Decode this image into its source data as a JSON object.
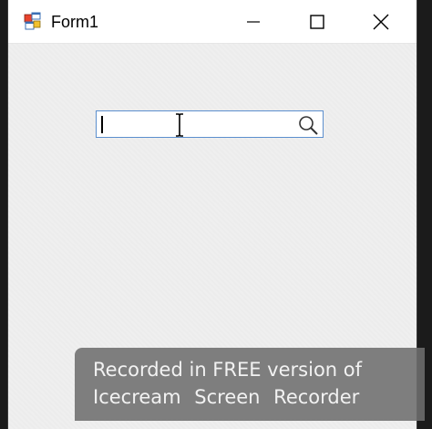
{
  "window": {
    "title": "Form1",
    "icon": "winforms-app-icon",
    "controls": {
      "minimize_icon": "minimize-icon",
      "maximize_icon": "maximize-icon",
      "close_icon": "close-icon"
    }
  },
  "form": {
    "search_input": {
      "value": "",
      "placeholder": "",
      "search_icon": "magnifier-icon",
      "focus_border_color": "#5c8fce"
    },
    "mouse_cursor": "ibeam-cursor"
  },
  "watermark": {
    "line1": "Recorded in FREE version of",
    "line2": "Icecream Screen Recorder"
  },
  "colors": {
    "titlebar": "#ffffff",
    "client_background": "#efefef",
    "outer_background": "#1b1b1b",
    "watermark_background": "#6e6e6e"
  }
}
